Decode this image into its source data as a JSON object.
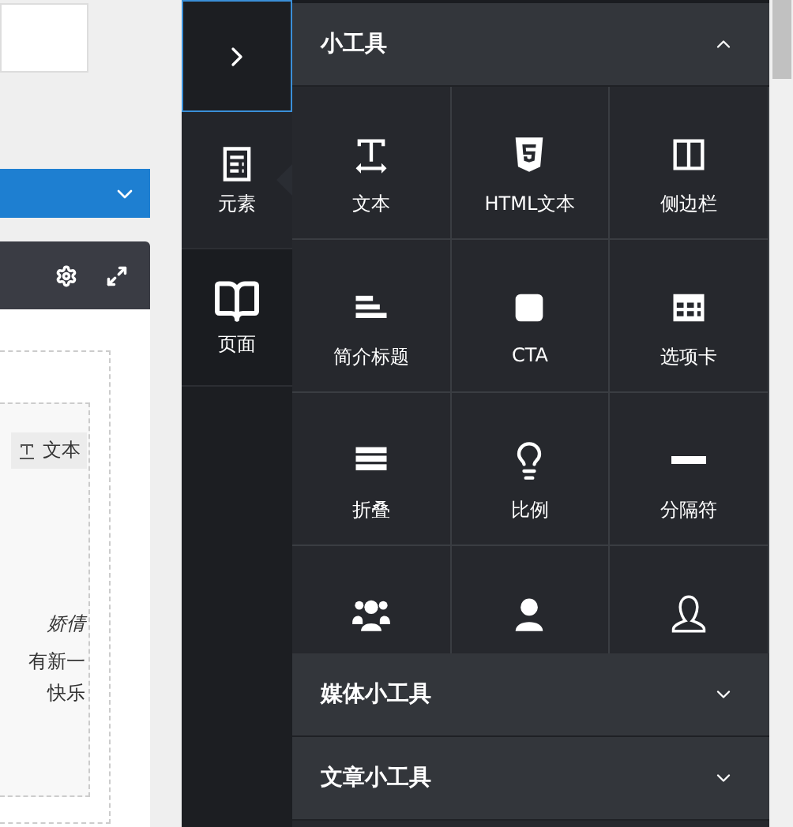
{
  "editor": {
    "tag_label": "文本",
    "text_lines": [
      "娇倩",
      "有新一",
      "快乐"
    ]
  },
  "sidebar": {
    "items": [
      {
        "label": "元素",
        "selected": true
      },
      {
        "label": "页面",
        "selected": false
      }
    ]
  },
  "sections": [
    {
      "title": "小工具",
      "expanded": true,
      "items": [
        {
          "kind": "labeled",
          "label": "文本"
        },
        {
          "kind": "labeled",
          "label": "HTML文本"
        },
        {
          "kind": "labeled",
          "label": "侧边栏"
        },
        {
          "kind": "labeled",
          "label": "简介标题"
        },
        {
          "kind": "labeled",
          "label": "CTA"
        },
        {
          "kind": "labeled",
          "label": "选项卡"
        },
        {
          "kind": "labeled",
          "label": "折叠"
        },
        {
          "kind": "labeled",
          "label": "比例"
        },
        {
          "kind": "labeled",
          "label": "分隔符"
        },
        {
          "kind": "icon_only"
        },
        {
          "kind": "icon_only"
        },
        {
          "kind": "icon_only"
        }
      ]
    },
    {
      "title": "媒体小工具",
      "expanded": false
    },
    {
      "title": "文章小工具",
      "expanded": false
    }
  ]
}
